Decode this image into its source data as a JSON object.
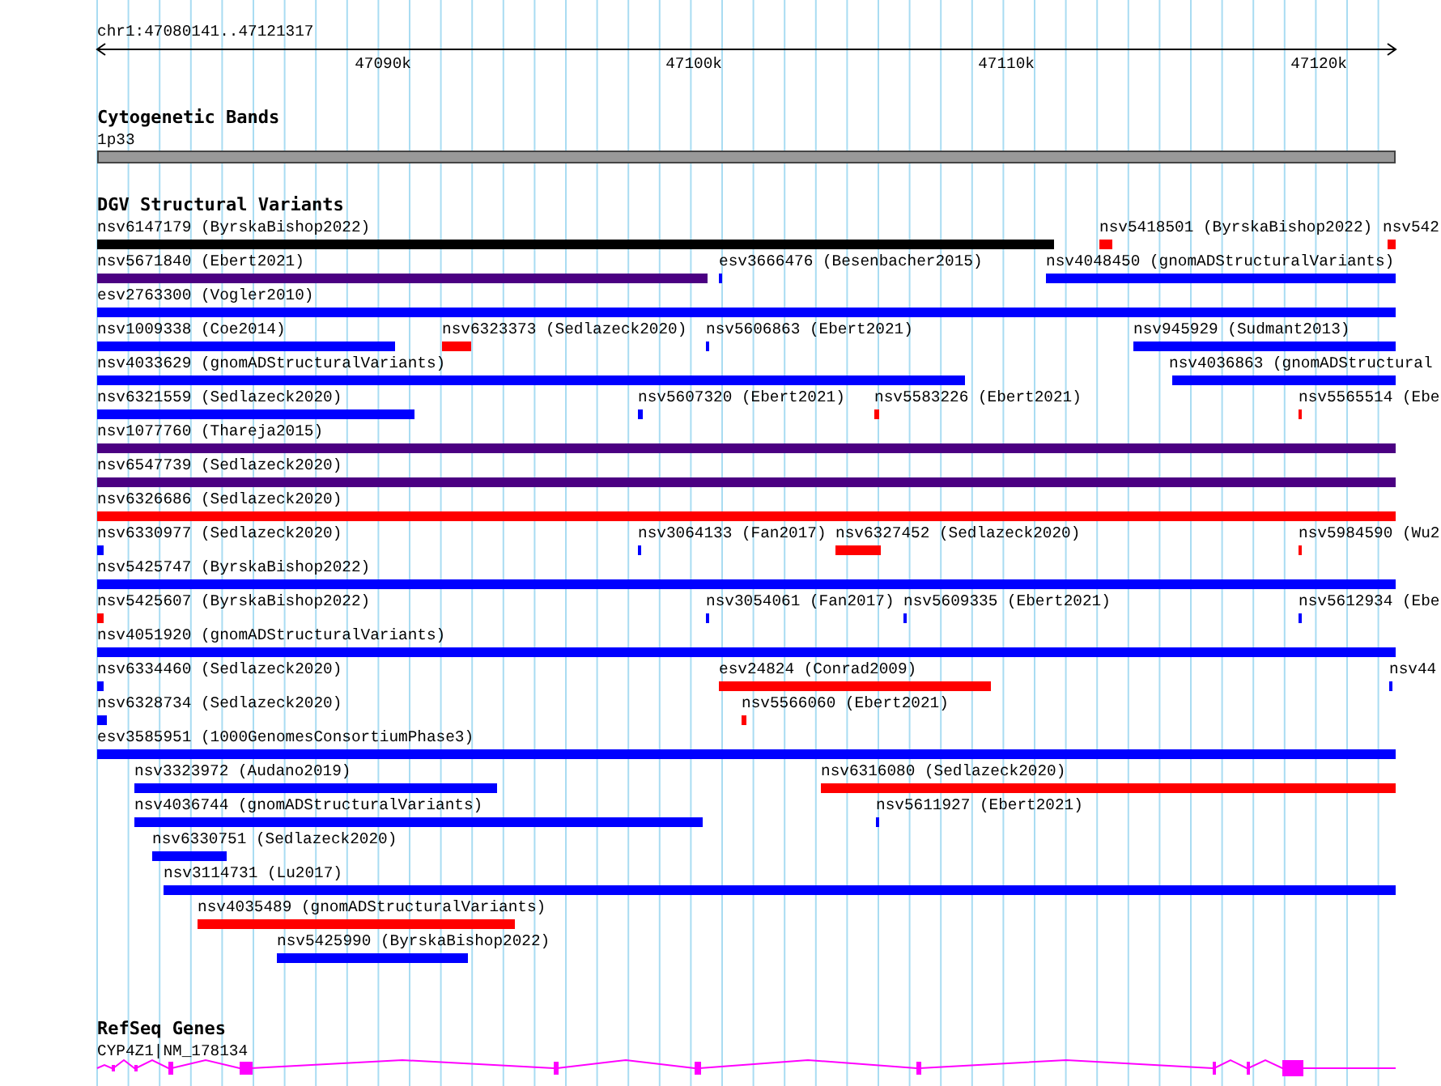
{
  "ruler": {
    "position": "chr1:47080141..47121317",
    "ticks": [
      "47090k",
      "47100k",
      "47110k",
      "47120k"
    ]
  },
  "tracks": [
    {
      "kind": "bands",
      "title": "Cytogenetic Bands",
      "items": [
        {
          "label": "1p33"
        }
      ]
    },
    {
      "kind": "variants",
      "title": "DGV Structural Variants",
      "rows": [
        {
          "features": [
            {
              "label": "nsv6147179 (ByrskaBishop2022)",
              "color": "#000000"
            },
            {
              "label": "nsv5418501 (ByrskaBishop2022)",
              "color": "#ff0000"
            },
            {
              "label": "nsv542",
              "color": "#ff0000"
            }
          ]
        },
        {
          "features": [
            {
              "label": "nsv5671840 (Ebert2021)",
              "color": "#4b0082"
            },
            {
              "label": "esv3666476 (Besenbacher2015)",
              "color": "#0000ff"
            },
            {
              "label": "nsv4048450 (gnomADStructuralVariants)",
              "color": "#0000ff"
            }
          ]
        },
        {
          "features": [
            {
              "label": "esv2763300 (Vogler2010)",
              "color": "#0000ff"
            }
          ]
        },
        {
          "features": [
            {
              "label": "nsv1009338 (Coe2014)",
              "color": "#0000ff"
            },
            {
              "label": "nsv6323373 (Sedlazeck2020)",
              "color": "#ff0000"
            },
            {
              "label": "nsv5606863 (Ebert2021)",
              "color": "#0000ff"
            },
            {
              "label": "nsv945929 (Sudmant2013)",
              "color": "#0000ff"
            }
          ]
        },
        {
          "features": [
            {
              "label": "nsv4033629 (gnomADStructuralVariants)",
              "color": "#0000ff"
            },
            {
              "label": "nsv4036863 (gnomADStructural",
              "color": "#0000ff"
            }
          ]
        },
        {
          "features": [
            {
              "label": "nsv6321559 (Sedlazeck2020)",
              "color": "#0000ff"
            },
            {
              "label": "nsv5607320 (Ebert2021)",
              "color": "#0000ff"
            },
            {
              "label": "nsv5583226 (Ebert2021)",
              "color": "#ff0000"
            },
            {
              "label": "nsv5565514 (Ebe",
              "color": "#ff0000"
            }
          ]
        },
        {
          "features": [
            {
              "label": "nsv1077760 (Thareja2015)",
              "color": "#4b0082"
            }
          ]
        },
        {
          "features": [
            {
              "label": "nsv6547739 (Sedlazeck2020)",
              "color": "#4b0082"
            }
          ]
        },
        {
          "features": [
            {
              "label": "nsv6326686 (Sedlazeck2020)",
              "color": "#ff0000"
            }
          ]
        },
        {
          "features": [
            {
              "label": "nsv6330977 (Sedlazeck2020)",
              "color": "#0000ff"
            },
            {
              "label": "nsv3064133 (Fan2017)",
              "color": "#0000ff"
            },
            {
              "label": "nsv6327452 (Sedlazeck2020)",
              "color": "#ff0000"
            },
            {
              "label": "nsv5984590 (Wu2",
              "color": "#ff0000"
            }
          ]
        },
        {
          "features": [
            {
              "label": "nsv5425747 (ByrskaBishop2022)",
              "color": "#0000ff"
            }
          ]
        },
        {
          "features": [
            {
              "label": "nsv5425607 (ByrskaBishop2022)",
              "color": "#ff0000"
            },
            {
              "label": "nsv3054061 (Fan2017)",
              "color": "#0000ff"
            },
            {
              "label": "nsv5609335 (Ebert2021)",
              "color": "#0000ff"
            },
            {
              "label": "nsv5612934 (Ebe",
              "color": "#0000ff"
            }
          ]
        },
        {
          "features": [
            {
              "label": "nsv4051920 (gnomADStructuralVariants)",
              "color": "#0000ff"
            }
          ]
        },
        {
          "features": [
            {
              "label": "nsv6334460 (Sedlazeck2020)",
              "color": "#0000ff"
            },
            {
              "label": "esv24824 (Conrad2009)",
              "color": "#ff0000"
            },
            {
              "label": "nsv44",
              "color": "#0000ff"
            }
          ]
        },
        {
          "features": [
            {
              "label": "nsv6328734 (Sedlazeck2020)",
              "color": "#0000ff"
            },
            {
              "label": "nsv5566060 (Ebert2021)",
              "color": "#ff0000"
            }
          ]
        },
        {
          "features": [
            {
              "label": "esv3585951 (1000GenomesConsortiumPhase3)",
              "color": "#0000ff"
            }
          ]
        },
        {
          "features": [
            {
              "label": "nsv3323972 (Audano2019)",
              "color": "#0000ff"
            },
            {
              "label": "nsv6316080 (Sedlazeck2020)",
              "color": "#ff0000"
            }
          ]
        },
        {
          "features": [
            {
              "label": "nsv4036744 (gnomADStructuralVariants)",
              "color": "#0000ff"
            },
            {
              "label": "nsv5611927 (Ebert2021)",
              "color": "#0000ff"
            }
          ]
        },
        {
          "features": [
            {
              "label": "nsv6330751 (Sedlazeck2020)",
              "color": "#0000ff"
            }
          ]
        },
        {
          "features": [
            {
              "label": "nsv3114731 (Lu2017)",
              "color": "#0000ff"
            }
          ]
        },
        {
          "features": [
            {
              "label": "nsv4035489 (gnomADStructuralVariants)",
              "color": "#ff0000"
            }
          ]
        },
        {
          "features": [
            {
              "label": "nsv5425990 (ByrskaBishop2022)",
              "color": "#0000ff"
            }
          ]
        }
      ]
    },
    {
      "kind": "genes",
      "title": "RefSeq Genes",
      "items": [
        {
          "label": "CYP4Z1|NM_178134"
        }
      ]
    }
  ]
}
